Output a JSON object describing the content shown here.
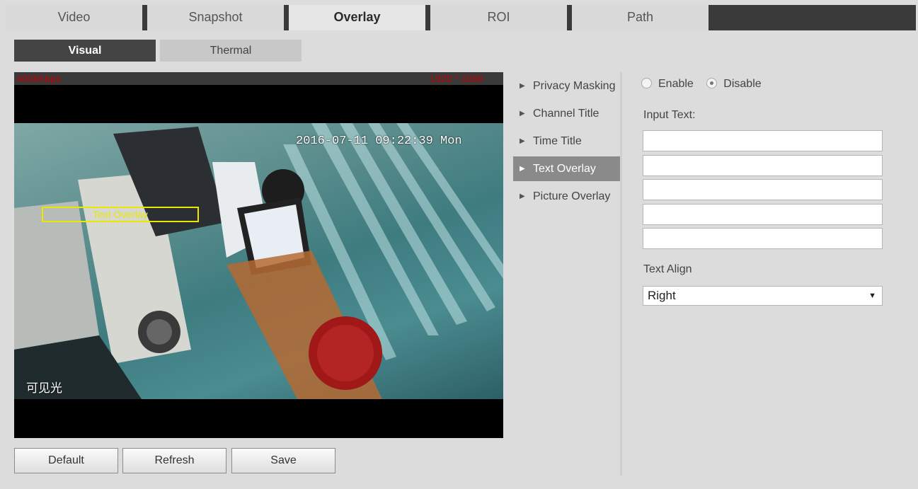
{
  "top_tabs": [
    "Video",
    "Snapshot",
    "Overlay",
    "ROI",
    "Path"
  ],
  "active_top_tab": "Overlay",
  "sub_tabs": [
    "Visual",
    "Thermal"
  ],
  "active_sub_tab": "Visual",
  "video": {
    "bitrate": "4004Kbps",
    "resolution": "1920 * 1080",
    "osd_time": "2016-07-11 09:22:39 Mon",
    "osd_text_overlay": "Text Overlay",
    "osd_channel": "可见光"
  },
  "buttons": {
    "default": "Default",
    "refresh": "Refresh",
    "save": "Save"
  },
  "menu": {
    "items": [
      "Privacy Masking",
      "Channel Title",
      "Time Title",
      "Text Overlay",
      "Picture Overlay"
    ],
    "active": "Text Overlay"
  },
  "panel": {
    "enable_label": "Enable",
    "disable_label": "Disable",
    "selected": "Disable",
    "input_text_label": "Input Text:",
    "inputs": [
      "",
      "",
      "",
      "",
      ""
    ],
    "text_align_label": "Text Align",
    "text_align_value": "Right"
  },
  "colors": {
    "osd_box": "#e8e800",
    "bitrate_text": "#c00000",
    "tab_bar": "#3a3a3a"
  }
}
